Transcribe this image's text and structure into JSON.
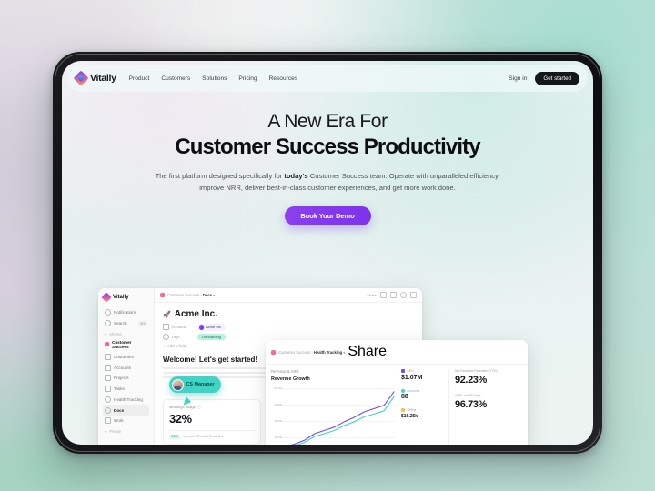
{
  "site": {
    "brand": "Vitally",
    "nav_links": [
      "Product",
      "Customers",
      "Solutions",
      "Pricing",
      "Resources"
    ],
    "sign_in": "Sign in",
    "get_started": "Get started"
  },
  "hero": {
    "eyebrow": "A New Era For",
    "headline": "Customer Success Productivity",
    "sub_before": "The first platform designed specifically for ",
    "sub_bold": "today's",
    "sub_after": " Customer Success team. Operate with unparalleled efficiency, improve NRR, deliver best-in-class customer experiences, and get more work done.",
    "cta": "Book Your Demo"
  },
  "app": {
    "sidebar": {
      "brand": "Vitally",
      "notifications": "Notifications",
      "search": "Search",
      "search_shortcut": "⌘K",
      "shared_group": "Shared",
      "workspace": "Customer Success",
      "items": [
        "Customers",
        "Accounts",
        "Projects",
        "Tasks",
        "Health Tracking",
        "Docs",
        "Work"
      ],
      "active_item": "Docs",
      "private_group": "Private"
    },
    "doc": {
      "breadcrumb_parent": "Customer Success",
      "breadcrumb_current": "Docs",
      "share": "Share",
      "title": "Acme Inc.",
      "prop_account_label": "Account",
      "prop_account_value": "Acme Inc.",
      "prop_tag_label": "Tags",
      "prop_tag_value": "Onboarding",
      "add_field": "Add a field",
      "welcome": "Welcome! Let's get started!"
    },
    "stat_card": {
      "label": "Meetings usage",
      "value": "32%",
      "delta": "26%",
      "note": "up from 12% last 3 months"
    },
    "cursor": {
      "label": "CS Manager"
    },
    "health": {
      "breadcrumb_parent": "Customer Success",
      "breadcrumb_current": "Health Tracking",
      "share": "Share",
      "section_label": "Revenue & ARR",
      "kpis": [
        {
          "label": "Net Revenue Retention (YTD)",
          "value": "92.23%"
        },
        {
          "label": "ARR Last 90 Days",
          "value": "96.73%"
        }
      ]
    }
  },
  "chart_data": {
    "type": "line",
    "title": "Revenue Growth",
    "xlabel": "",
    "ylabel": "",
    "ylim": [
      0,
      1200000
    ],
    "grid": true,
    "legend_position": "right",
    "tick_labels": [
      "$1.2M",
      "$900k",
      "$600k",
      "$300k"
    ],
    "x": [
      0,
      1,
      2,
      3,
      4,
      5,
      6,
      7,
      8,
      9,
      10,
      11
    ],
    "series": [
      {
        "name": "ARR",
        "color": "#6d4df6",
        "legend_value": "$1.07M",
        "values": [
          60000,
          110000,
          180000,
          300000,
          360000,
          420000,
          520000,
          600000,
          700000,
          760000,
          820000,
          1070000
        ]
      },
      {
        "name": "Accounts",
        "color": "#3fd4c5",
        "legend_value": "88",
        "values": [
          40000,
          80000,
          140000,
          250000,
          300000,
          360000,
          450000,
          520000,
          610000,
          660000,
          720000,
          980000
        ]
      }
    ],
    "annotations": [
      "$16.25k"
    ]
  }
}
